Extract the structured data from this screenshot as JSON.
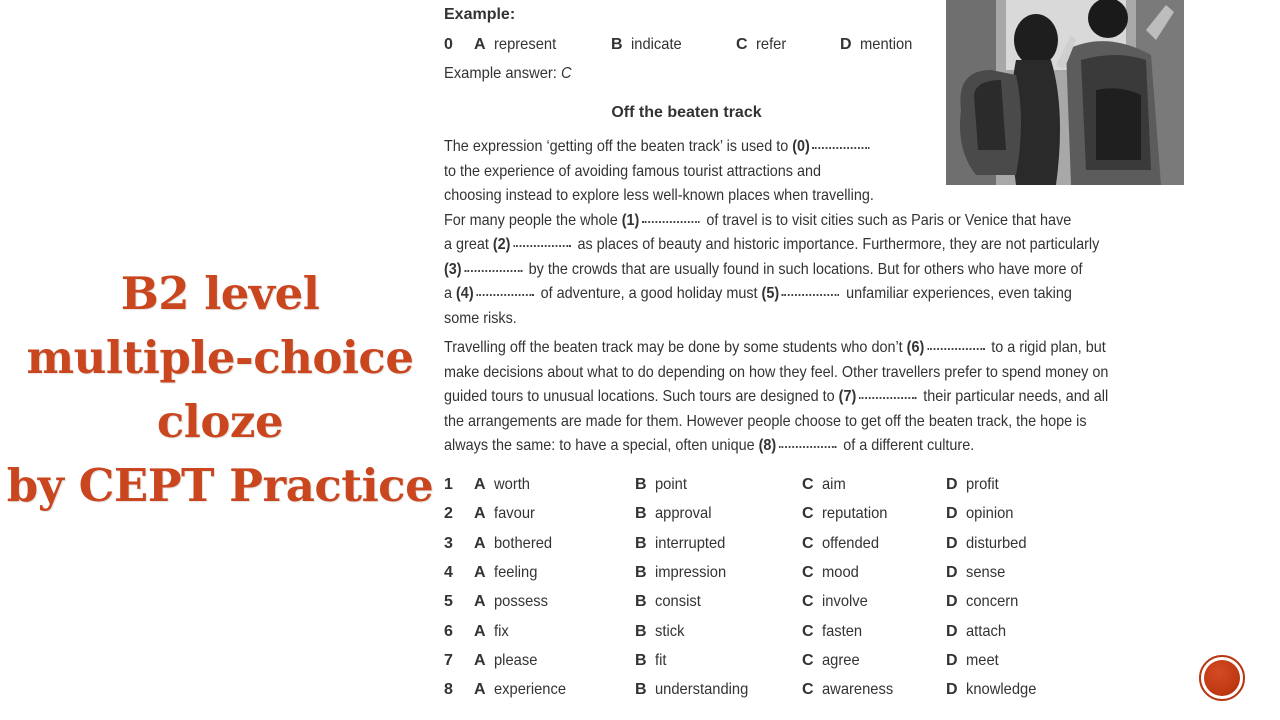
{
  "slide_title": {
    "lines": [
      "B2 level",
      "multiple-choice",
      "cloze",
      "by CEPT Practice"
    ],
    "color": "#c9461f"
  },
  "example": {
    "label": "Example:",
    "number": "0",
    "options": [
      {
        "letter": "A",
        "word": "represent"
      },
      {
        "letter": "B",
        "word": "indicate"
      },
      {
        "letter": "C",
        "word": "refer"
      },
      {
        "letter": "D",
        "word": "mention"
      }
    ],
    "answer_label": "Example answer:",
    "answer_value": "C"
  },
  "passage": {
    "title": "Off the beaten track",
    "paragraph1": [
      {
        "pre": "The expression ‘getting off the beaten track’ is used to ",
        "gap": "(0)",
        "post": ""
      },
      {
        "pre": "to the experience of avoiding famous tourist attractions and",
        "gap": "",
        "post": ""
      },
      {
        "pre": "choosing instead to explore less well-known places when travelling.",
        "gap": "",
        "post": ""
      },
      {
        "pre": "For many people the whole ",
        "gap": "(1)",
        "post": " of travel is to visit cities such as Paris or Venice that have"
      },
      {
        "pre": "a great ",
        "gap": "(2)",
        "post": " as places of beauty and historic importance. Furthermore, they are not particularly"
      },
      {
        "pre": "",
        "gap": "(3)",
        "post": " by the crowds that are usually found in such locations. But for others who have more of"
      },
      {
        "pre": "a ",
        "gap": "(4)",
        "post": " of adventure, a good holiday must ",
        "gap2": "(5)",
        "post2": " unfamiliar experiences, even taking"
      },
      {
        "pre": "some risks.",
        "gap": "",
        "post": ""
      }
    ],
    "paragraph2": [
      {
        "pre": "Travelling off the beaten track may be done by some students who don’t ",
        "gap": "(6)",
        "post": " to a rigid plan, but"
      },
      {
        "pre": "make decisions about what to do depending on how they feel. Other travellers prefer to spend money on",
        "gap": "",
        "post": ""
      },
      {
        "pre": "guided tours to unusual locations. Such tours are designed to ",
        "gap": "(7)",
        "post": " their particular needs, and all"
      },
      {
        "pre": "the arrangements are made for them. However people choose to get off the beaten track, the hope is",
        "gap": "",
        "post": ""
      },
      {
        "pre": "always the same: to have a special, often unique ",
        "gap": "(8)",
        "post": " of a different culture."
      }
    ]
  },
  "photo": {
    "description": "Two backpackers viewed from behind, black-and-white photo"
  },
  "questions": [
    {
      "number": "1",
      "options": [
        {
          "letter": "A",
          "word": "worth"
        },
        {
          "letter": "B",
          "word": "point"
        },
        {
          "letter": "C",
          "word": "aim"
        },
        {
          "letter": "D",
          "word": "profit"
        }
      ]
    },
    {
      "number": "2",
      "options": [
        {
          "letter": "A",
          "word": "favour"
        },
        {
          "letter": "B",
          "word": "approval"
        },
        {
          "letter": "C",
          "word": "reputation"
        },
        {
          "letter": "D",
          "word": "opinion"
        }
      ]
    },
    {
      "number": "3",
      "options": [
        {
          "letter": "A",
          "word": "bothered"
        },
        {
          "letter": "B",
          "word": "interrupted"
        },
        {
          "letter": "C",
          "word": "offended"
        },
        {
          "letter": "D",
          "word": "disturbed"
        }
      ]
    },
    {
      "number": "4",
      "options": [
        {
          "letter": "A",
          "word": "feeling"
        },
        {
          "letter": "B",
          "word": "impression"
        },
        {
          "letter": "C",
          "word": "mood"
        },
        {
          "letter": "D",
          "word": "sense"
        }
      ]
    },
    {
      "number": "5",
      "options": [
        {
          "letter": "A",
          "word": "possess"
        },
        {
          "letter": "B",
          "word": "consist"
        },
        {
          "letter": "C",
          "word": "involve"
        },
        {
          "letter": "D",
          "word": "concern"
        }
      ]
    },
    {
      "number": "6",
      "options": [
        {
          "letter": "A",
          "word": "fix"
        },
        {
          "letter": "B",
          "word": "stick"
        },
        {
          "letter": "C",
          "word": "fasten"
        },
        {
          "letter": "D",
          "word": "attach"
        }
      ]
    },
    {
      "number": "7",
      "options": [
        {
          "letter": "A",
          "word": "please"
        },
        {
          "letter": "B",
          "word": "fit"
        },
        {
          "letter": "C",
          "word": "agree"
        },
        {
          "letter": "D",
          "word": "meet"
        }
      ]
    },
    {
      "number": "8",
      "options": [
        {
          "letter": "A",
          "word": "experience"
        },
        {
          "letter": "B",
          "word": "understanding"
        },
        {
          "letter": "C",
          "word": "awareness"
        },
        {
          "letter": "D",
          "word": "knowledge"
        }
      ]
    }
  ],
  "nav": {
    "icon": "slide-nav-circle-icon",
    "accent": "#c13a14"
  }
}
